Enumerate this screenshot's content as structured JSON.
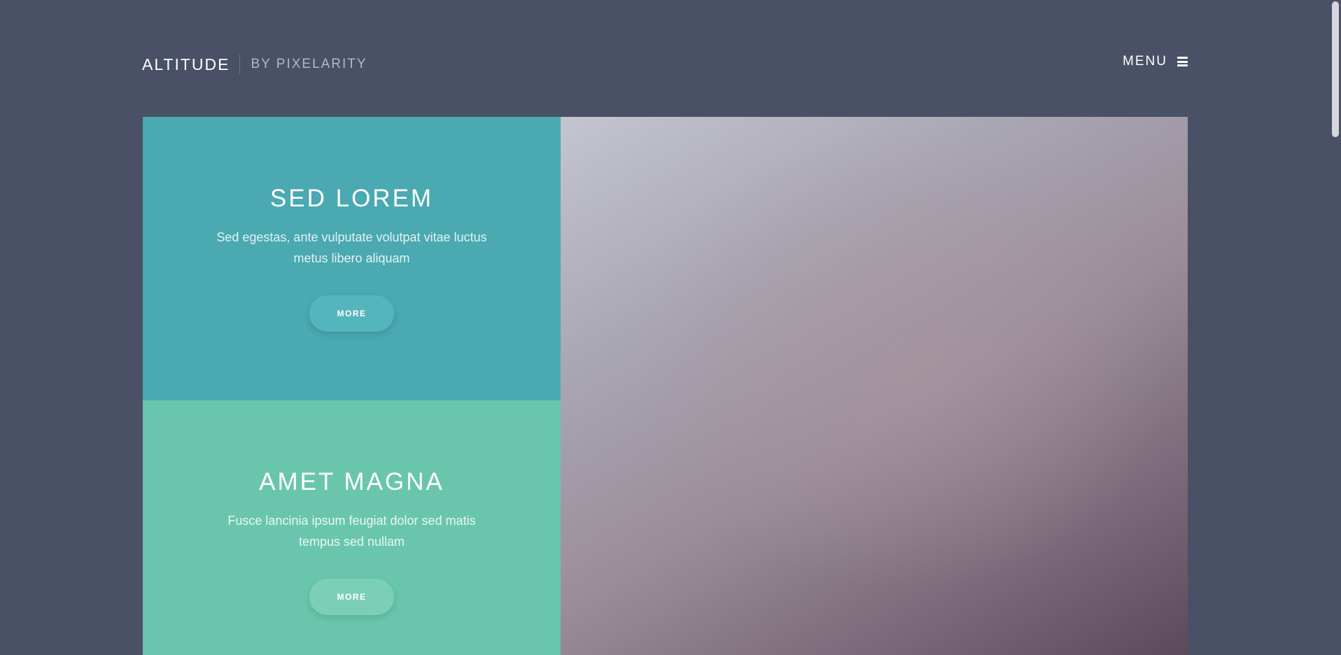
{
  "header": {
    "brand_title": "ALTITUDE",
    "brand_subtitle": "BY PIXELARITY",
    "menu_label": "MENU"
  },
  "tiles": [
    {
      "title": "SED LOREM",
      "text": "Sed egestas, ante vulputate volutpat vitae luctus metus libero aliquam",
      "button_label": "MORE",
      "color": "#4aa9b1"
    },
    {
      "title": "AMET MAGNA",
      "text": "Fusce lancinia ipsum feugiat dolor sed matis tempus sed nullam",
      "button_label": "MORE",
      "color": "#69c6ac"
    }
  ],
  "icons": {
    "menu": "hamburger-icon"
  },
  "colors": {
    "background": "#4a5166"
  }
}
